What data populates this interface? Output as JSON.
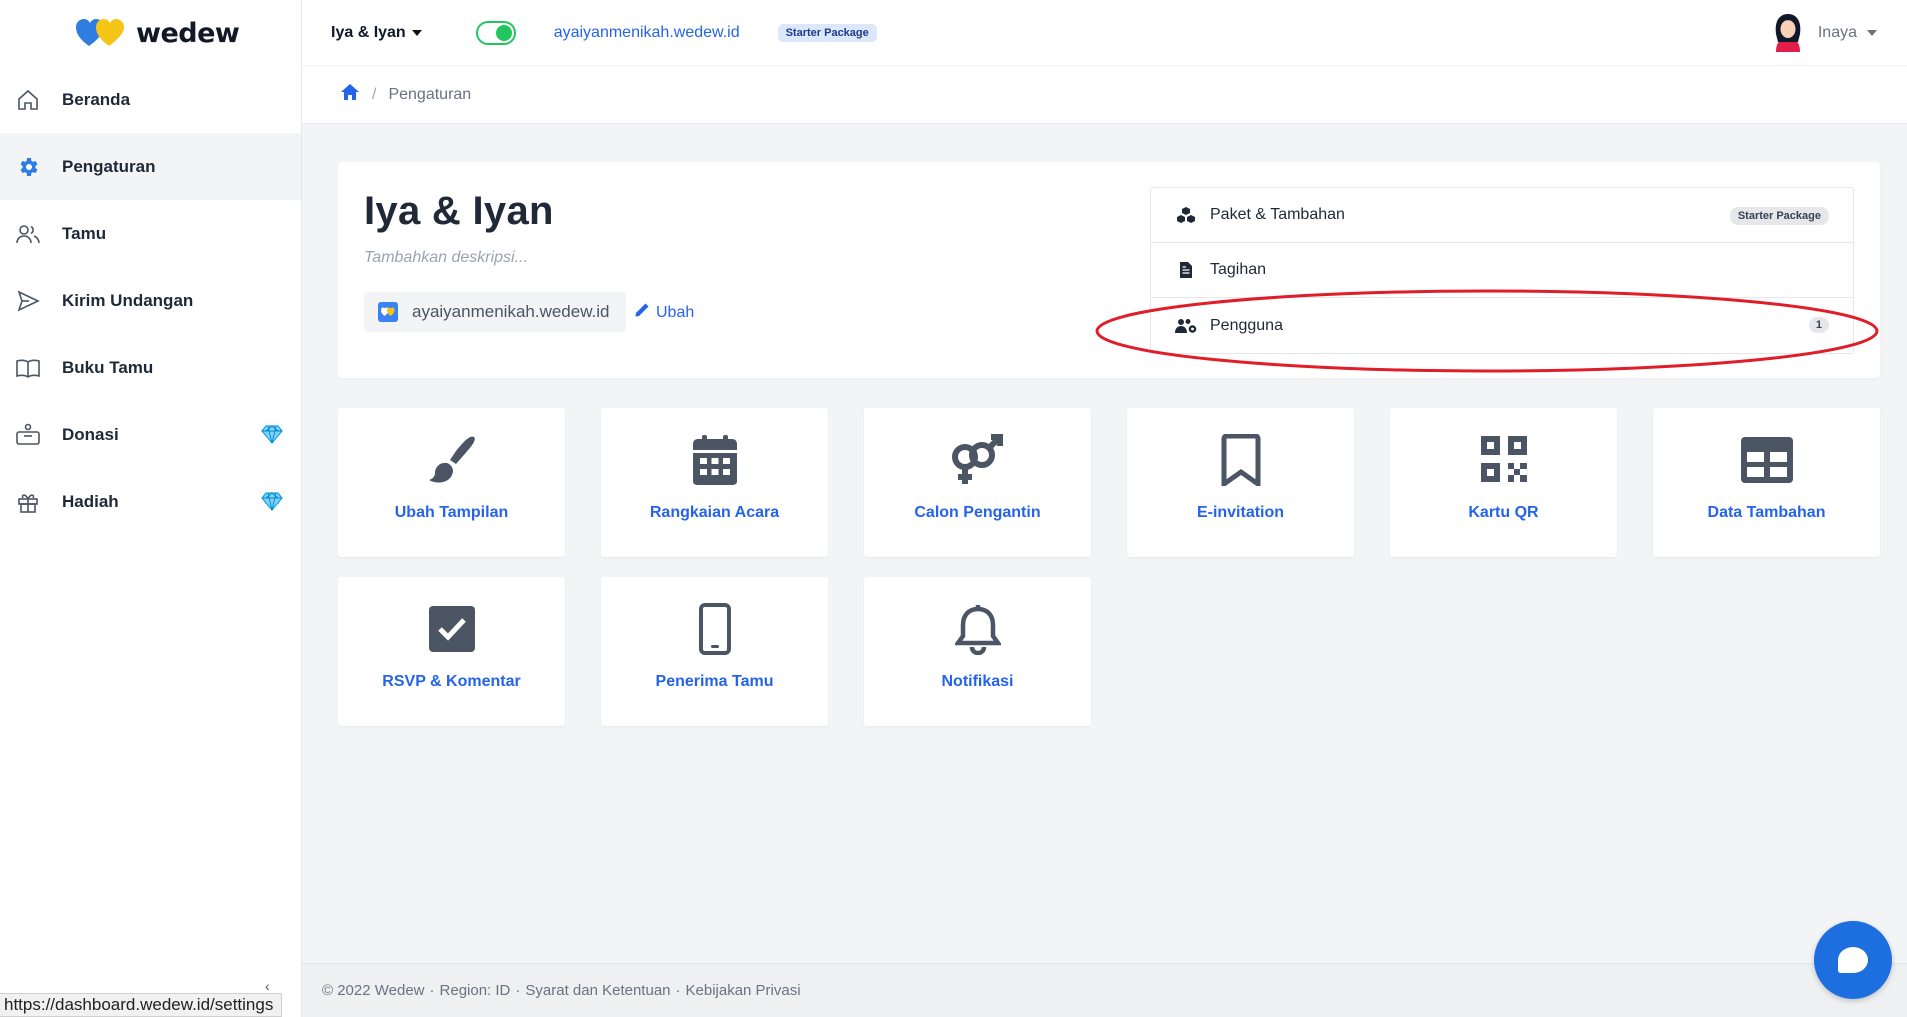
{
  "brand": {
    "name": "wedew"
  },
  "sidebar": {
    "items": [
      {
        "label": "Beranda",
        "icon": "home-icon",
        "active": false,
        "premium": false
      },
      {
        "label": "Pengaturan",
        "icon": "gear-icon",
        "active": true,
        "premium": false
      },
      {
        "label": "Tamu",
        "icon": "users-icon",
        "active": false,
        "premium": false
      },
      {
        "label": "Kirim Undangan",
        "icon": "send-icon",
        "active": false,
        "premium": false
      },
      {
        "label": "Buku Tamu",
        "icon": "book-icon",
        "active": false,
        "premium": false
      },
      {
        "label": "Donasi",
        "icon": "donation-box-icon",
        "active": false,
        "premium": true
      },
      {
        "label": "Hadiah",
        "icon": "gift-icon",
        "active": false,
        "premium": true
      }
    ]
  },
  "topbar": {
    "event_name": "Iya & Iyan",
    "domain": "ayaiyanmenikah.wedew.id",
    "package": "Starter Package",
    "user_name": "Inaya",
    "toggle_on": true
  },
  "breadcrumb": {
    "current": "Pengaturan",
    "separator": "/"
  },
  "event": {
    "title": "Iya & Iyan",
    "description_placeholder": "Tambahkan deskripsi...",
    "domain": "ayaiyanmenikah.wedew.id",
    "edit_label": "Ubah"
  },
  "side_menu": {
    "paket": {
      "label": "Paket & Tambahan",
      "badge": "Starter Package"
    },
    "tagihan": {
      "label": "Tagihan"
    },
    "pengguna": {
      "label": "Pengguna",
      "badge": "1"
    }
  },
  "tiles": [
    {
      "label": "Ubah Tampilan",
      "icon": "brush-icon"
    },
    {
      "label": "Rangkaian Acara",
      "icon": "calendar-icon"
    },
    {
      "label": "Calon Pengantin",
      "icon": "gender-icon"
    },
    {
      "label": "E-invitation",
      "icon": "bookmark-icon"
    },
    {
      "label": "Kartu QR",
      "icon": "qrcode-icon"
    },
    {
      "label": "Data Tambahan",
      "icon": "table-icon"
    },
    {
      "label": "RSVP & Komentar",
      "icon": "checkbox-icon"
    },
    {
      "label": "Penerima Tamu",
      "icon": "mobile-icon"
    },
    {
      "label": "Notifikasi",
      "icon": "bell-icon"
    }
  ],
  "footer": {
    "copyright": "© 2022 Wedew",
    "region": "Region: ID",
    "terms": "Syarat dan Ketentuan",
    "privacy": "Kebijakan Privasi"
  },
  "status_bar": {
    "url": "https://dashboard.wedew.id/settings"
  },
  "colors": {
    "accent": "#2563eb",
    "toggle": "#22c55e",
    "highlight": "#e11d2a",
    "icon_grey": "#4b5563"
  }
}
